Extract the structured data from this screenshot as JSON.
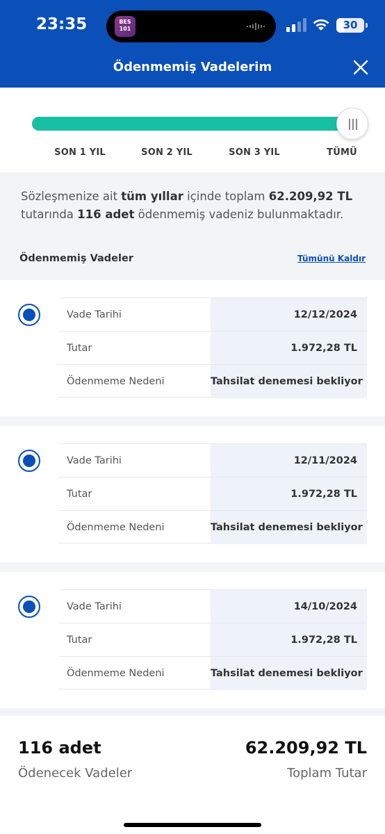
{
  "status_bar": {
    "time": "23:35",
    "app_badge_line1": "BES",
    "app_badge_line2": "101",
    "battery": "30",
    "battery_percent": 30
  },
  "header": {
    "title": "Ödenmemiş Vadelerim"
  },
  "slider": {
    "options": [
      "SON 1 YIL",
      "SON 2 YIL",
      "SON 3 YIL",
      "TÜMÜ"
    ],
    "selected": "TÜMÜ",
    "fill_fraction": 1.0
  },
  "summary": {
    "p1": "Sözleşmenize ait ",
    "b1": "tüm yıllar",
    "p2": " içinde toplam ",
    "b2": "62.209,92 TL",
    "p3": " tutarında ",
    "b3": "116 adet",
    "p4": " ödenmemiş vadeniz bulunmaktadır."
  },
  "section": {
    "title": "Ödenmemiş Vadeler",
    "remove_all": "Tümünü Kaldır"
  },
  "installments": [
    {
      "date_label": "Vade Tarihi",
      "date": "12/12/2024",
      "amount_label": "Tutar",
      "amount": "1.972,28 TL",
      "reason_label": "Ödenmeme Nedeni",
      "reason": "Tahsilat denemesi bekliyor",
      "selected": true
    },
    {
      "date_label": "Vade Tarihi",
      "date": "12/11/2024",
      "amount_label": "Tutar",
      "amount": "1.972,28 TL",
      "reason_label": "Ödenmeme Nedeni",
      "reason": "Tahsilat denemesi bekliyor",
      "selected": true
    },
    {
      "date_label": "Vade Tarihi",
      "date": "14/10/2024",
      "amount_label": "Tutar",
      "amount": "1.972,28 TL",
      "reason_label": "Ödenmeme Nedeni",
      "reason": "Tahsilat denemesi bekliyor",
      "selected": true
    }
  ],
  "footer": {
    "count": "116 adet",
    "count_label": "Ödenecek Vadeler",
    "total": "62.209,92 TL",
    "total_label": "Toplam Tutar"
  },
  "colors": {
    "header_blue": "#0b4fb8",
    "slider_teal": "#17bfa5"
  }
}
